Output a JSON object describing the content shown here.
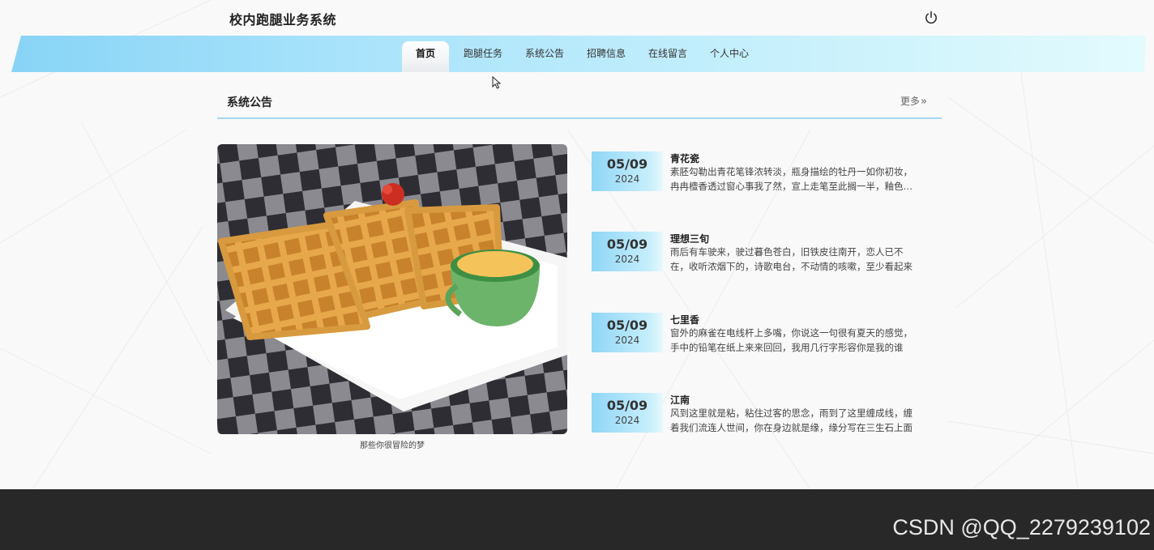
{
  "header": {
    "site_title": "校内跑腿业务系统",
    "logout_icon": "power-icon"
  },
  "nav": {
    "items": [
      {
        "label": "首页",
        "active": true
      },
      {
        "label": "跑腿任务",
        "active": false
      },
      {
        "label": "系统公告",
        "active": false
      },
      {
        "label": "招聘信息",
        "active": false
      },
      {
        "label": "在线留言",
        "active": false
      },
      {
        "label": "个人中心",
        "active": false
      }
    ]
  },
  "section": {
    "title": "系统公告",
    "more_label": "更多",
    "more_icon": "double-chevron-right-icon"
  },
  "feature": {
    "image_subject": "waffles with jam on white plate over checkered tablecloth",
    "caption": "那些你很冒险的梦"
  },
  "news": [
    {
      "date_md": "05/09",
      "year": "2024",
      "title": "青花瓷",
      "text": "素胚勾勒出青花笔锋浓转淡，瓶身描绘的牡丹一如你初妆，冉冉檀香透过窗心事我了然，宣上走笔至此搁一半，釉色渲染仕女图"
    },
    {
      "date_md": "05/09",
      "year": "2024",
      "title": "理想三旬",
      "text": "雨后有车驶来，驶过暮色苍白，旧铁皮往南开，恋人已不在，收听浓烟下的，诗歌电台，不动情的咳嗽，至少看起来"
    },
    {
      "date_md": "05/09",
      "year": "2024",
      "title": "七里香",
      "text": "窗外的麻雀在电线杆上多嘴，你说这一句很有夏天的感觉，手中的铅笔在纸上来来回回，我用几行字形容你是我的谁"
    },
    {
      "date_md": "05/09",
      "year": "2024",
      "title": "江南",
      "text": "风到这里就是粘，粘住过客的思念，雨到了这里缠成线，缠着我们流连人世间，你在身边就是缘，缘分写在三生石上面"
    }
  ],
  "footer": {
    "watermark": "CSDN @QQ_2279239102"
  },
  "colors": {
    "nav_gradient_start": "#88d4f6",
    "nav_gradient_end": "#e3fbfd",
    "accent_line": "#a3d8ee",
    "footer_bg": "#282828"
  }
}
